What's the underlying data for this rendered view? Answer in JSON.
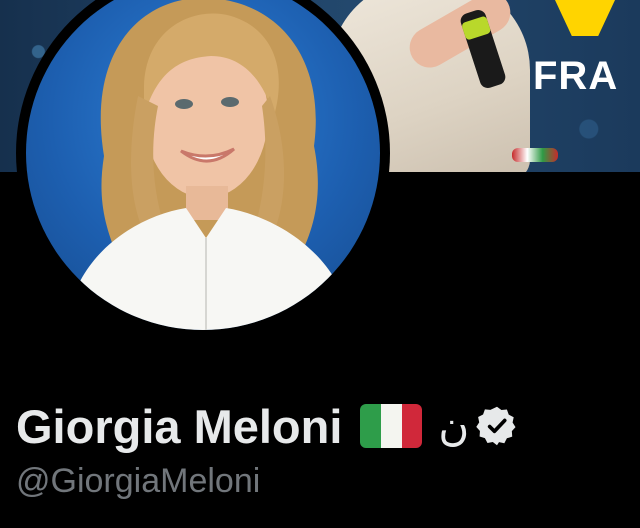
{
  "profile": {
    "display_name": "Giorgia Meloni",
    "handle": "@GiorgiaMeloni",
    "badge_glyph": "ن",
    "flag_colors": [
      "#2e9d4a",
      "#f4f5f0",
      "#d0283a"
    ],
    "verified_color": "#e7e9ea"
  },
  "banner": {
    "text": "FRA",
    "logo_color": "#ffd400"
  },
  "icons": {
    "flag": "italy-flag-icon",
    "verified": "verified-badge-icon"
  }
}
